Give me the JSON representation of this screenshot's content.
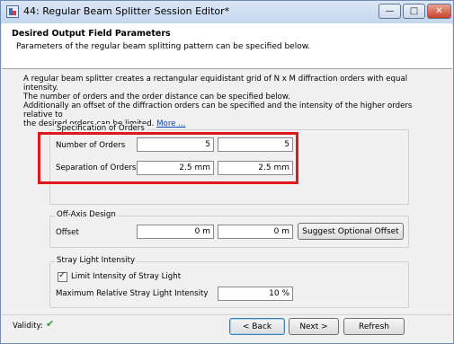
{
  "window": {
    "title": "44: Regular Beam Splitter Session Editor*",
    "controls": {
      "minimize": "—",
      "maximize": "□",
      "close": "✕"
    }
  },
  "header": {
    "title": "Desired Output Field Parameters",
    "subtitle": "Parameters of the regular beam splitting pattern can be specified below."
  },
  "intro": {
    "line1": "A regular beam splitter creates a rectangular equidistant grid of N x M diffraction orders with equal intensity.",
    "line2": "The number of orders and the order distance can be specified below.",
    "line3": "Additionally an offset of the diffraction orders can be specified and the intensity of the higher orders relative to",
    "line4": "the desired orders can be limited.",
    "more_link": "More ..."
  },
  "orders": {
    "group_title": "Specification of Orders",
    "number_label": "Number of Orders",
    "number_n": "5",
    "number_m": "5",
    "separation_label": "Separation of Orders",
    "separation_x": "2.5 mm",
    "separation_y": "2.5 mm"
  },
  "offaxis": {
    "group_title": "Off-Axis Design",
    "offset_label": "Offset",
    "offset_x": "0 m",
    "offset_y": "0 m",
    "suggest_button": "Suggest Optional Offset"
  },
  "straylight": {
    "group_title": "Stray Light Intensity",
    "limit_label": "Limit Intensity of Stray Light",
    "limit_checked": true,
    "max_label": "Maximum Relative Stray Light Intensity",
    "max_value": "10 %"
  },
  "footer": {
    "validity_label": "Validity:",
    "validity_icon": "✔",
    "back_button": "< Back",
    "next_button": "Next >",
    "refresh_button": "Refresh"
  },
  "colors": {
    "highlight": "#e01818",
    "validity": "#2e9b2e",
    "link": "#0645ad"
  }
}
